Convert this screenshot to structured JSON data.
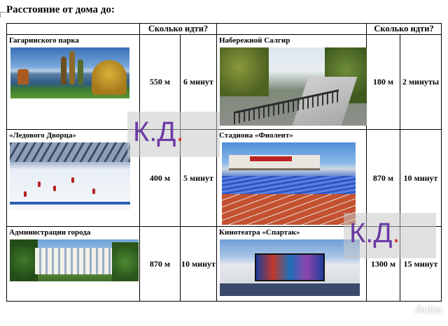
{
  "page": {
    "title": "Расстояние от дома до:"
  },
  "table": {
    "header": "Сколько идти?",
    "rows": [
      {
        "left": {
          "name": "Гагаринского парка",
          "distance": "550 м",
          "time": "6 минут",
          "image": "park-lake-photo"
        },
        "right": {
          "name": "Набережной Салгир",
          "distance": "180 м",
          "time": "2 минуты",
          "image": "embankment-photo"
        }
      },
      {
        "left": {
          "name": "«Ледового Дворца»",
          "distance": "400 м",
          "time": "5 минут",
          "image": "ice-rink-photo"
        },
        "right": {
          "name": "Стадиона «Фиолент»",
          "distance": "870 м",
          "time": "10 минут",
          "image": "stadium-photo"
        }
      },
      {
        "left": {
          "name": "Администрации города",
          "distance": "870 м",
          "time": "10 минут",
          "image": "administration-building-photo"
        },
        "right": {
          "name": "Кинотеатра «Спартак»",
          "distance": "1300 м",
          "time": "15 минут",
          "image": "cinema-photo"
        }
      }
    ]
  },
  "watermarks": {
    "text_main": "К.Д",
    "text_dot": "."
  },
  "avito": {
    "label": "Avito"
  },
  "colors": {
    "watermark_text": "#6c3aa5",
    "watermark_dot": "#d33d2d"
  }
}
